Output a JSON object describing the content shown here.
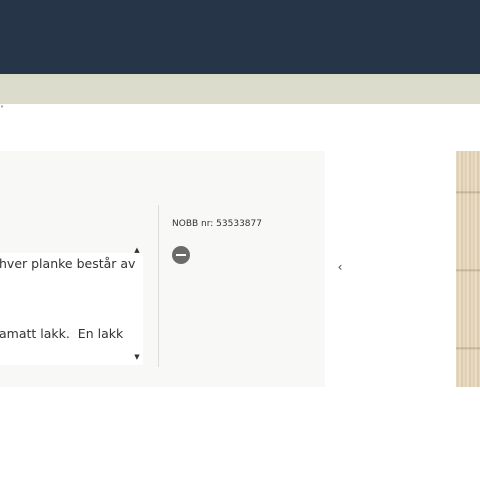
{
  "header": {
    "breadcrumb_chevron": "˅"
  },
  "product": {
    "description_text": "hver planke består av\n\namatt lakk.  En lakk",
    "nobb_label": "NOBB nr: 53533877"
  },
  "icons": {
    "scroll_up": "scroll-up-icon",
    "scroll_down": "scroll-down-icon",
    "remove": "minus-circle-icon",
    "gallery_prev": "chevron-left-icon"
  },
  "glyphs": {
    "scroll_up": "▲",
    "scroll_down": "▼",
    "gallery_prev": "‹"
  },
  "colors": {
    "header": "#263547",
    "subheader": "#dcdccc",
    "panel": "#f8f8f6",
    "icon_dark": "#6b6b6b"
  }
}
